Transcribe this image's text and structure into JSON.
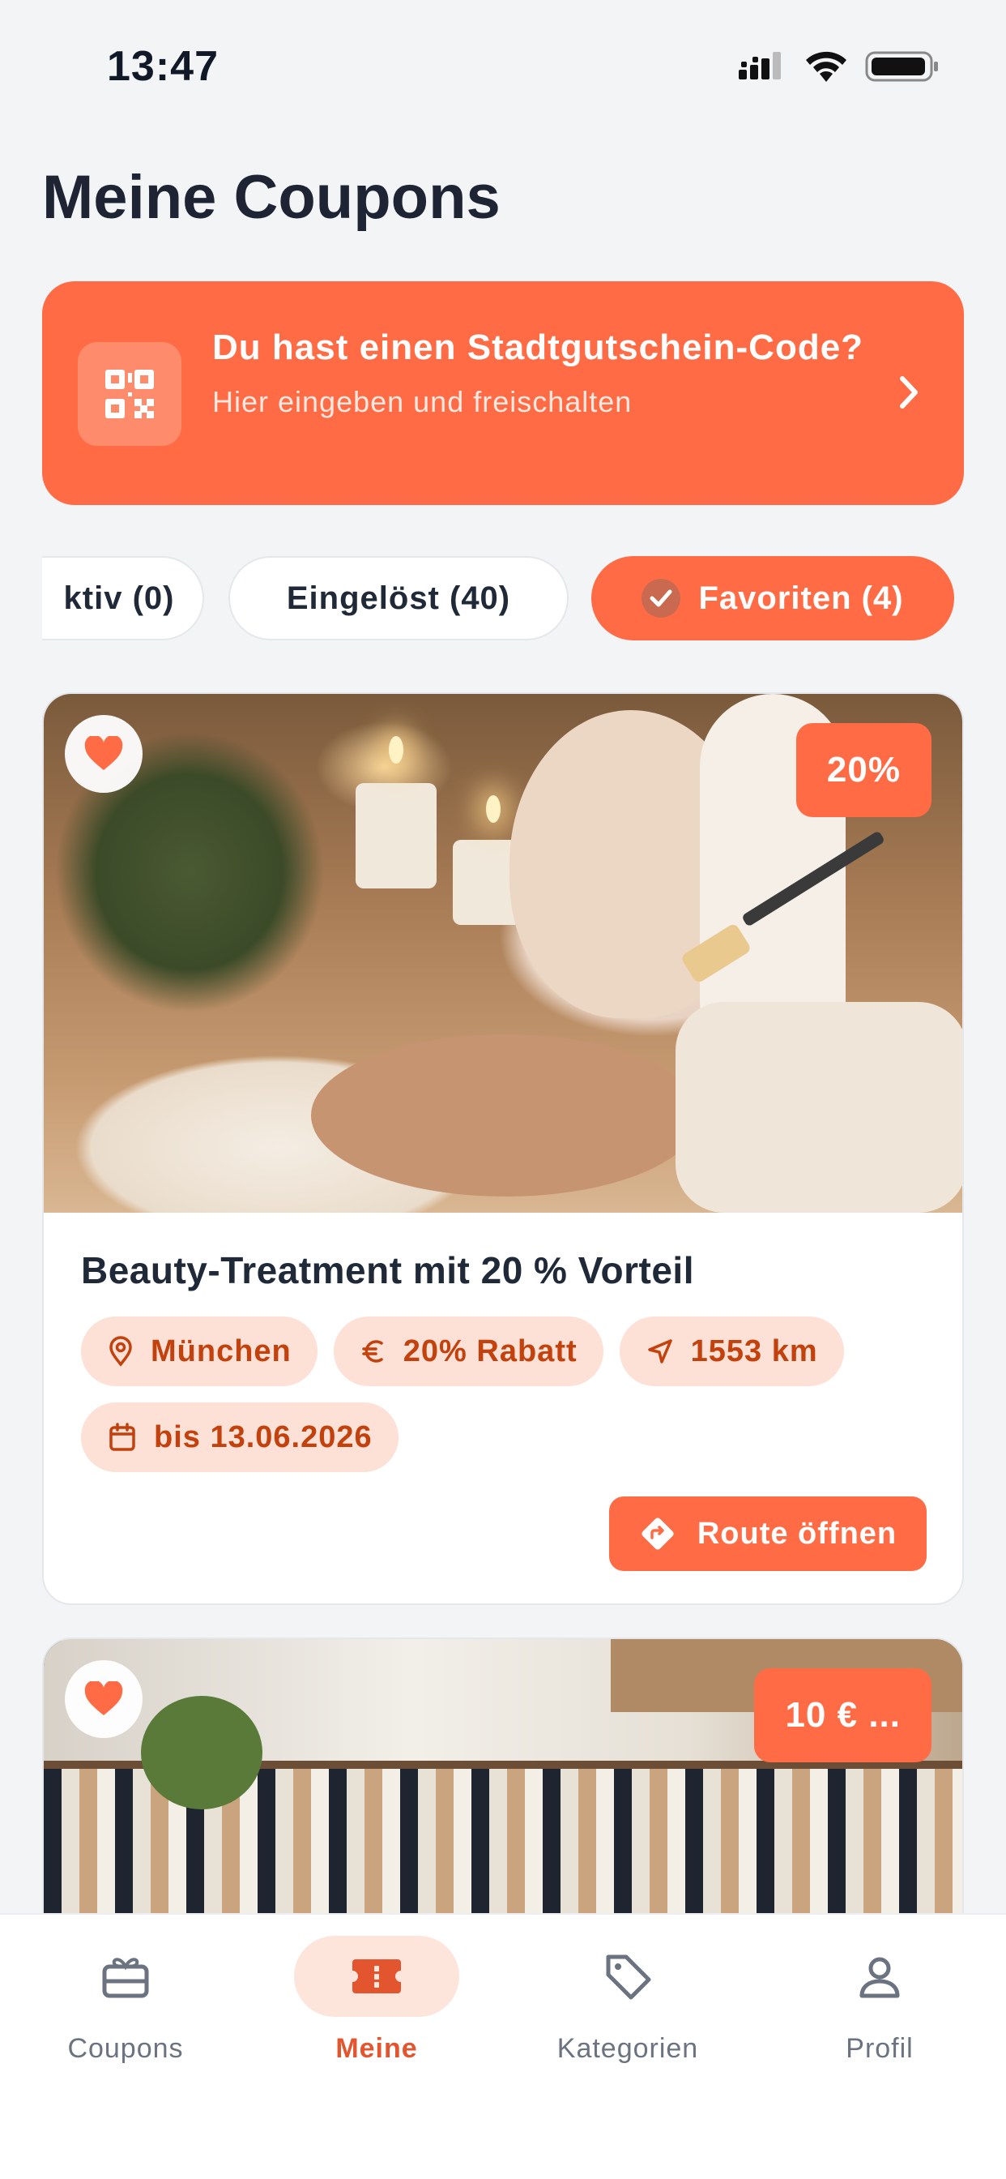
{
  "status_bar": {
    "time": "13:47"
  },
  "page_title": "Meine Coupons",
  "banner": {
    "title": "Du hast einen Stadtgutschein-Code?",
    "subtitle": "Hier eingeben und freischalten"
  },
  "tabs": [
    {
      "label": "ktiv (0)",
      "active": false
    },
    {
      "label": "Eingelöst (40)",
      "active": false
    },
    {
      "label": "Favoriten (4)",
      "active": true
    }
  ],
  "coupons": [
    {
      "title": "Beauty-Treatment mit 20 % Vorteil",
      "badge": "20%",
      "favorite": true,
      "chips": {
        "city": "München",
        "discount": "20% Rabatt",
        "distance": "1553 km",
        "valid_until": "bis 13.06.2026"
      },
      "route_label": "Route öffnen"
    },
    {
      "badge": "10 € ...",
      "favorite": true
    }
  ],
  "bottom_nav": [
    {
      "label": "Coupons",
      "icon": "gift-card-icon",
      "active": false
    },
    {
      "label": "Meine",
      "icon": "ticket-icon",
      "active": true
    },
    {
      "label": "Kategorien",
      "icon": "tag-icon",
      "active": false
    },
    {
      "label": "Profil",
      "icon": "user-icon",
      "active": false
    }
  ],
  "colors": {
    "accent": "#ff6b45",
    "chip_bg": "#fde0d6",
    "chip_text": "#c2410c",
    "background": "#f3f4f6"
  }
}
